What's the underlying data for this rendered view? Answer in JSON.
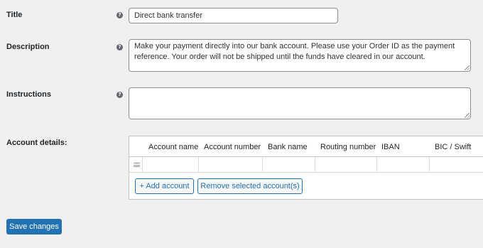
{
  "fields": {
    "title": {
      "label": "Title",
      "value": "Direct bank transfer"
    },
    "description": {
      "label": "Description",
      "value": "Make your payment directly into our bank account. Please use your Order ID as the payment reference. Your order will not be shipped until the funds have cleared in our account."
    },
    "instructions": {
      "label": "Instructions",
      "value": ""
    }
  },
  "help_glyph": "?",
  "account_details": {
    "label": "Account details:",
    "columns": [
      "Account name",
      "Account number",
      "Bank name",
      "Routing number",
      "IBAN",
      "BIC / Swift"
    ],
    "add_label": "+ Add account",
    "remove_label": "Remove selected account(s)"
  },
  "save_label": "Save changes",
  "icons": {
    "help": "help-circle-icon",
    "drag": "drag-handle-icon"
  },
  "colors": {
    "accent": "#2271b1",
    "background": "#f0f0f1",
    "border": "#8c8f94"
  }
}
